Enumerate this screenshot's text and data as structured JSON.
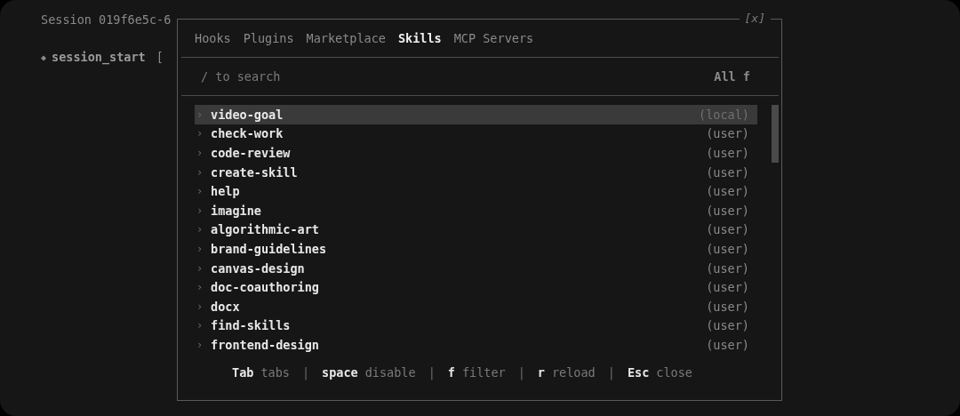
{
  "session": {
    "title": "Session 019f6e5c-6",
    "event_marker": "◆",
    "event": "session_start",
    "bracket": "["
  },
  "dialog": {
    "close": "[x]",
    "tabs": [
      {
        "label": "Hooks",
        "selected": false
      },
      {
        "label": "Plugins",
        "selected": false
      },
      {
        "label": "Marketplace",
        "selected": false
      },
      {
        "label": "Skills",
        "selected": true
      },
      {
        "label": "MCP Servers",
        "selected": false
      }
    ],
    "search": {
      "placeholder": "/ to search"
    },
    "filter": "All f",
    "skills": [
      {
        "chevron": "›",
        "name": "video-goal",
        "source": "(local)",
        "selected": true
      },
      {
        "chevron": "›",
        "name": "check-work",
        "source": "(user)",
        "selected": false
      },
      {
        "chevron": "›",
        "name": "code-review",
        "source": "(user)",
        "selected": false
      },
      {
        "chevron": "›",
        "name": "create-skill",
        "source": "(user)",
        "selected": false
      },
      {
        "chevron": "›",
        "name": "help",
        "source": "(user)",
        "selected": false
      },
      {
        "chevron": "›",
        "name": "imagine",
        "source": "(user)",
        "selected": false
      },
      {
        "chevron": "›",
        "name": "algorithmic-art",
        "source": "(user)",
        "selected": false
      },
      {
        "chevron": "›",
        "name": "brand-guidelines",
        "source": "(user)",
        "selected": false
      },
      {
        "chevron": "›",
        "name": "canvas-design",
        "source": "(user)",
        "selected": false
      },
      {
        "chevron": "›",
        "name": "doc-coauthoring",
        "source": "(user)",
        "selected": false
      },
      {
        "chevron": "›",
        "name": "docx",
        "source": "(user)",
        "selected": false
      },
      {
        "chevron": "›",
        "name": "find-skills",
        "source": "(user)",
        "selected": false
      },
      {
        "chevron": "›",
        "name": "frontend-design",
        "source": "(user)",
        "selected": false
      }
    ],
    "footer": {
      "separator": "|",
      "shortcuts": [
        {
          "key": "Tab",
          "action": "tabs"
        },
        {
          "key": "space",
          "action": "disable"
        },
        {
          "key": "f",
          "action": "filter"
        },
        {
          "key": "r",
          "action": "reload"
        },
        {
          "key": "Esc",
          "action": "close"
        }
      ]
    }
  }
}
